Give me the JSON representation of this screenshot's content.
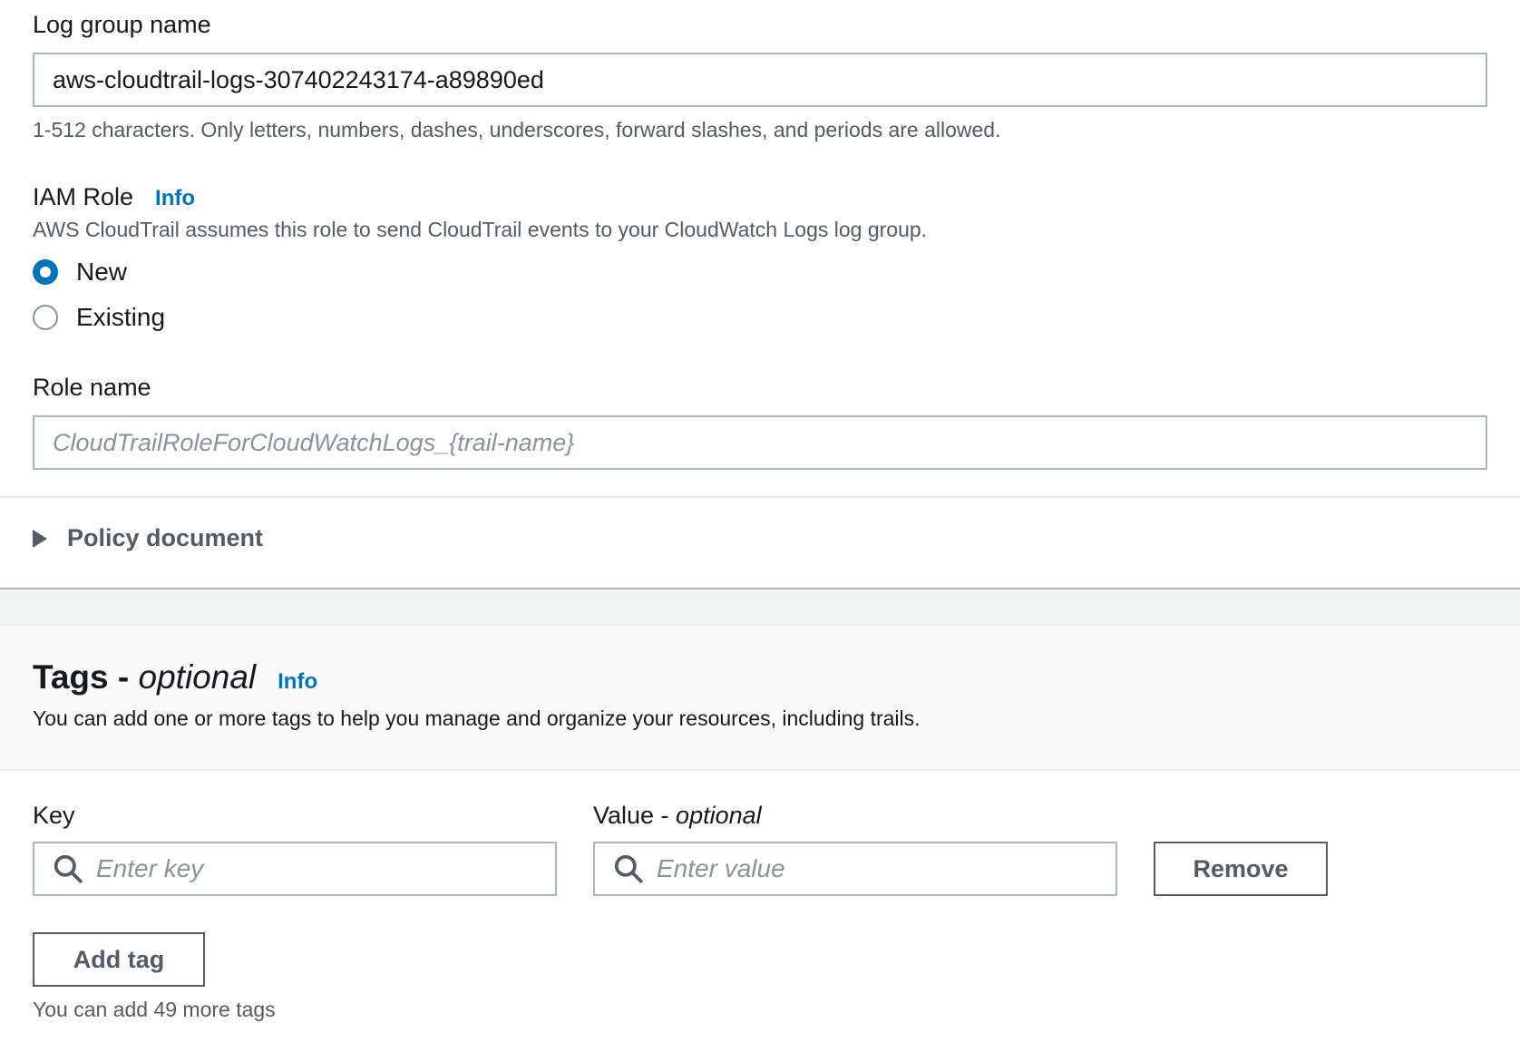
{
  "log_group": {
    "label": "Log group name",
    "value": "aws-cloudtrail-logs-307402243174-a89890ed",
    "constraint": "1-512 characters. Only letters, numbers, dashes, underscores, forward slashes, and periods are allowed."
  },
  "iam_role": {
    "label": "IAM Role",
    "info": "Info",
    "description": "AWS CloudTrail assumes this role to send CloudTrail events to your CloudWatch Logs log group.",
    "options": [
      {
        "label": "New",
        "selected": true
      },
      {
        "label": "Existing",
        "selected": false
      }
    ]
  },
  "role_name": {
    "label": "Role name",
    "placeholder": "CloudTrailRoleForCloudWatchLogs_{trail-name}"
  },
  "policy_document": {
    "label": "Policy document"
  },
  "tags": {
    "title": "Tags",
    "title_sep": " - ",
    "title_optional": "optional",
    "info": "Info",
    "description": "You can add one or more tags to help you manage and organize your resources, including trails.",
    "key_label": "Key",
    "value_label": "Value - ",
    "value_optional": "optional",
    "key_placeholder": "Enter key",
    "value_placeholder": "Enter value",
    "remove_label": "Remove",
    "add_label": "Add tag",
    "remaining": "You can add 49 more tags"
  },
  "colors": {
    "accent": "#0073bb",
    "text": "#16191f",
    "secondary_text": "#545b64",
    "border": "#aab7b8"
  }
}
